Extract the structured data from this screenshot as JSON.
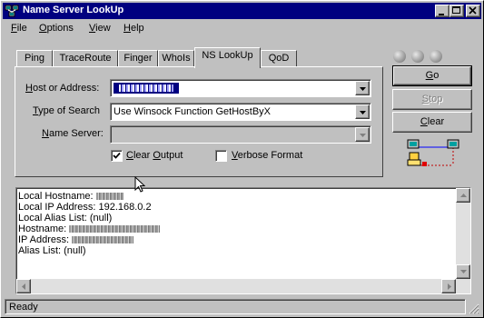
{
  "window": {
    "title": "Name Server LookUp"
  },
  "menu": [
    {
      "label": "File",
      "key": "F",
      "rest": "ile"
    },
    {
      "label": "Options",
      "key": "O",
      "rest": "ptions"
    },
    {
      "label": "View",
      "key": "V",
      "rest": "iew"
    },
    {
      "label": "Help",
      "key": "H",
      "rest": "elp"
    }
  ],
  "tabs": [
    "Ping",
    "TraceRoute",
    "Finger",
    "WhoIs",
    "NS LookUp",
    "QoD"
  ],
  "active_tab": "NS LookUp",
  "form": {
    "host_label": {
      "key": "H",
      "rest": "ost or Address:"
    },
    "type_label": {
      "key": "T",
      "rest": "ype of Search"
    },
    "ns_label": {
      "key": "N",
      "rest": "ame Server:"
    },
    "type_value": "Use Winsock Function GetHostByX",
    "clear_output": {
      "key": "C",
      "rest": "lear ",
      "key2": "O",
      "rest2": "utput",
      "checked": true
    },
    "verbose_format": {
      "key": "V",
      "rest": "erbose Format",
      "checked": false
    }
  },
  "buttons": {
    "go": {
      "key": "G",
      "rest": "o"
    },
    "stop": {
      "key": "S",
      "rest": "top"
    },
    "clear": {
      "key": "C",
      "rest": "lear"
    }
  },
  "output": {
    "local_hostname": "Local Hostname:",
    "local_ip": "Local IP Address: 192.168.0.2",
    "local_alias": "Local Alias List: (null)",
    "hostname": "Hostname:",
    "ip": "IP Address:",
    "alias": "Alias List: (null)"
  },
  "status": {
    "text": "Ready"
  },
  "colors": {
    "titlebar": "#000080",
    "face": "#c0c0c0",
    "selection": "#000080"
  }
}
